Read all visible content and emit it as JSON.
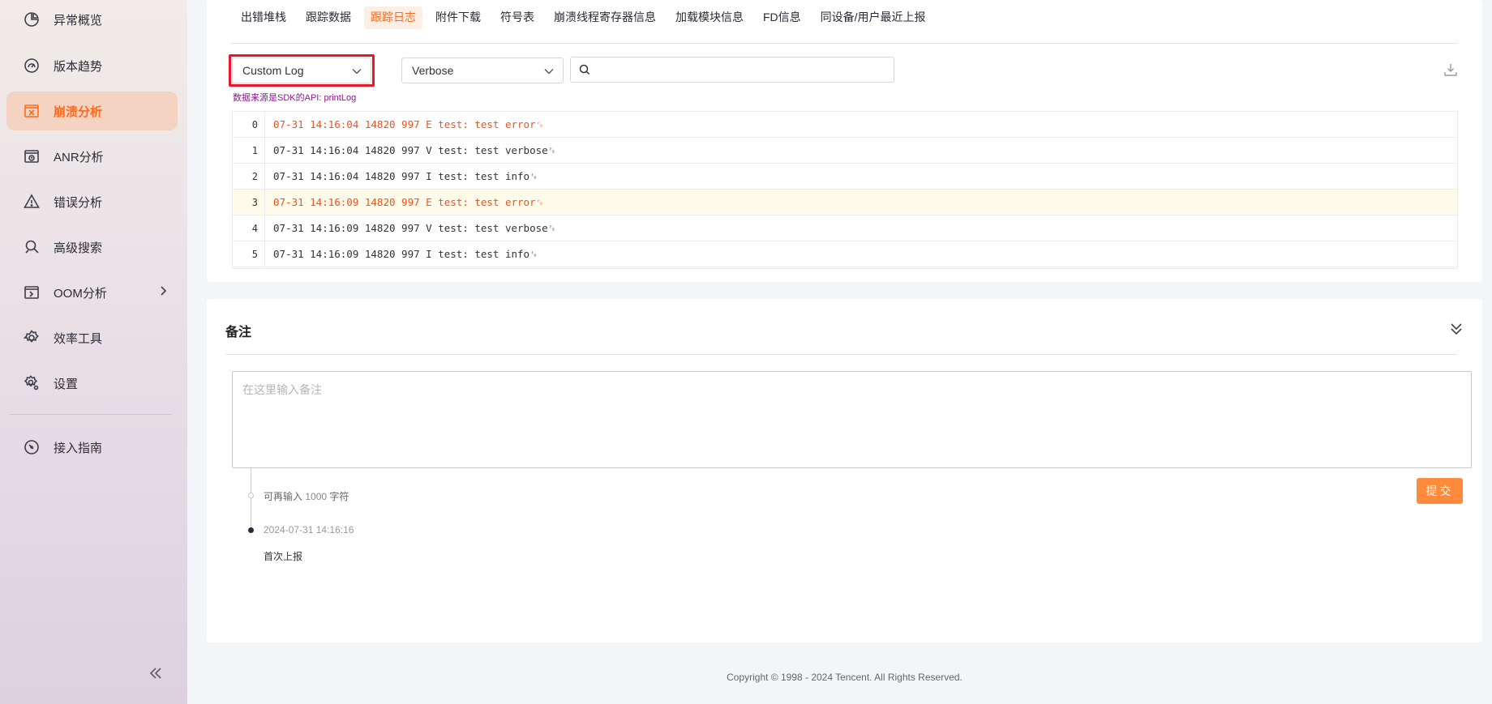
{
  "sidebar": {
    "items": [
      {
        "label": "异常概览",
        "icon": "pie-chart-icon"
      },
      {
        "label": "版本趋势",
        "icon": "gauge-icon"
      },
      {
        "label": "崩溃分析",
        "icon": "crash-icon",
        "active": true
      },
      {
        "label": "ANR分析",
        "icon": "anr-icon"
      },
      {
        "label": "错误分析",
        "icon": "warning-icon"
      },
      {
        "label": "高级搜索",
        "icon": "magnifier-icon"
      },
      {
        "label": "OOM分析",
        "icon": "oom-icon",
        "has_submenu": true
      },
      {
        "label": "效率工具",
        "icon": "gear-icon"
      },
      {
        "label": "设置",
        "icon": "settings-icon"
      },
      {
        "label": "接入指南",
        "icon": "compass-icon"
      }
    ],
    "collapse_icon": "double-chevron-left-icon"
  },
  "tabs": [
    {
      "label": "出错堆栈"
    },
    {
      "label": "跟踪数据"
    },
    {
      "label": "跟踪日志",
      "active": true
    },
    {
      "label": "附件下载"
    },
    {
      "label": "符号表"
    },
    {
      "label": "崩溃线程寄存器信息"
    },
    {
      "label": "加载模块信息"
    },
    {
      "label": "FD信息"
    },
    {
      "label": "同设备/用户最近上报"
    }
  ],
  "filters": {
    "log_type": "Custom Log",
    "log_level": "Verbose",
    "search_value": "",
    "source_note": "数据来源是SDK的API: printLog"
  },
  "logs": [
    {
      "line": "0",
      "text": "07-31 14:16:04 14820 997 E test: test error␜",
      "level": "E"
    },
    {
      "line": "1",
      "text": "07-31 14:16:04 14820 997 V test: test verbose␜",
      "level": "V"
    },
    {
      "line": "2",
      "text": "07-31 14:16:04 14820 997 I test: test info␜",
      "level": "I"
    },
    {
      "line": "3",
      "text": "07-31 14:16:09 14820 997 E test: test error␜",
      "level": "E",
      "highlighted": true
    },
    {
      "line": "4",
      "text": "07-31 14:16:09 14820 997 V test: test verbose␜",
      "level": "V"
    },
    {
      "line": "5",
      "text": "07-31 14:16:09 14820 997 I test: test info␜",
      "level": "I"
    }
  ],
  "note": {
    "title": "备注",
    "placeholder": "在这里输入备注",
    "remaining_prefix": "可再输入",
    "remaining_count": "1000",
    "remaining_suffix": "字符",
    "submit_label": "提交",
    "timeline_date": "2024-07-31 14:16:16",
    "timeline_event": "首次上报"
  },
  "footer": {
    "copyright": "Copyright © 1998 - 2024 Tencent. All Rights Reserved."
  },
  "colors": {
    "accent": "#ff6a1a",
    "error_text": "#f0521e",
    "highlight_border": "#e8172a",
    "submit_bg": "#ff8a3c"
  }
}
